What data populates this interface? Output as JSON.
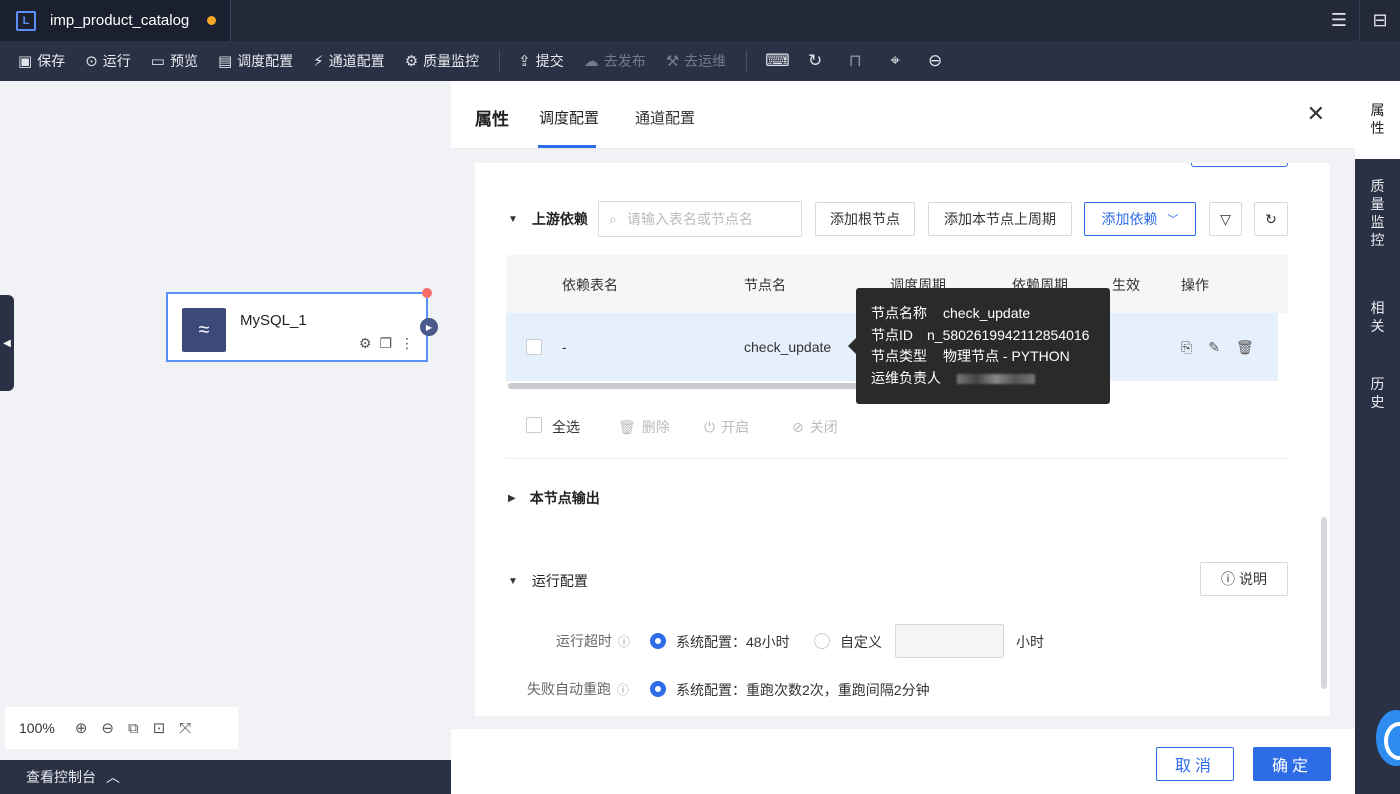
{
  "tab": {
    "title": "imp_product_catalog",
    "logo": "L"
  },
  "toolbar": {
    "save": "保存",
    "run": "运行",
    "preview": "预览",
    "schedule": "调度配置",
    "channel": "通道配置",
    "quality": "质量监控",
    "submit": "提交",
    "publish": "去发布",
    "ops": "去运维"
  },
  "canvas": {
    "node_name": "MySQL_1",
    "zoom": "100%",
    "console": "查看控制台"
  },
  "panel": {
    "tabs": {
      "props": "属性",
      "schedule": "调度配置",
      "channel": "通道配置"
    },
    "upstream": {
      "title": "上游依赖",
      "search_placeholder": "请输入表名或节点名",
      "add_root": "添加根节点",
      "add_prev": "添加本节点上周期",
      "add_dep": "添加依赖"
    },
    "table": {
      "headers": {
        "dep_table": "依赖表名",
        "node": "节点名",
        "cycle": "调度周期",
        "dep_cycle": "依赖周期",
        "effective": "生效",
        "ops": "操作"
      },
      "rows": [
        {
          "dep_table": "-",
          "node": "check_update"
        }
      ]
    },
    "bulk": {
      "select_all": "全选",
      "delete": "删除",
      "enable": "开启",
      "disable": "关闭"
    },
    "tooltip": {
      "name_label": "节点名称",
      "name_value": "check_update",
      "id_label": "节点ID",
      "id_value": "n_5802619942112854016",
      "type_label": "节点类型",
      "type_value": "物理节点 - PYTHON",
      "owner_label": "运维负责人"
    },
    "output": {
      "title": "本节点输出"
    },
    "run_config": {
      "title": "运行配置",
      "help": "说明",
      "timeout_label": "运行超时",
      "timeout_system": "系统配置：48小时",
      "timeout_custom": "自定义",
      "timeout_unit": "小时",
      "rerun_label": "失败自动重跑",
      "rerun_system": "系统配置：重跑次数2次，重跑间隔2分钟"
    },
    "footer": {
      "cancel": "取消",
      "ok": "确定"
    }
  },
  "right_sidebar": {
    "props": "属\n性",
    "quality": "质\n量\n监\n控",
    "related": "相\n关",
    "history": "历\n史"
  },
  "colors": {
    "accent": "#2e6be6",
    "toolbar_bg": "#2b3144",
    "topbar_bg": "#232939",
    "unsaved_dot": "#f5a623"
  }
}
